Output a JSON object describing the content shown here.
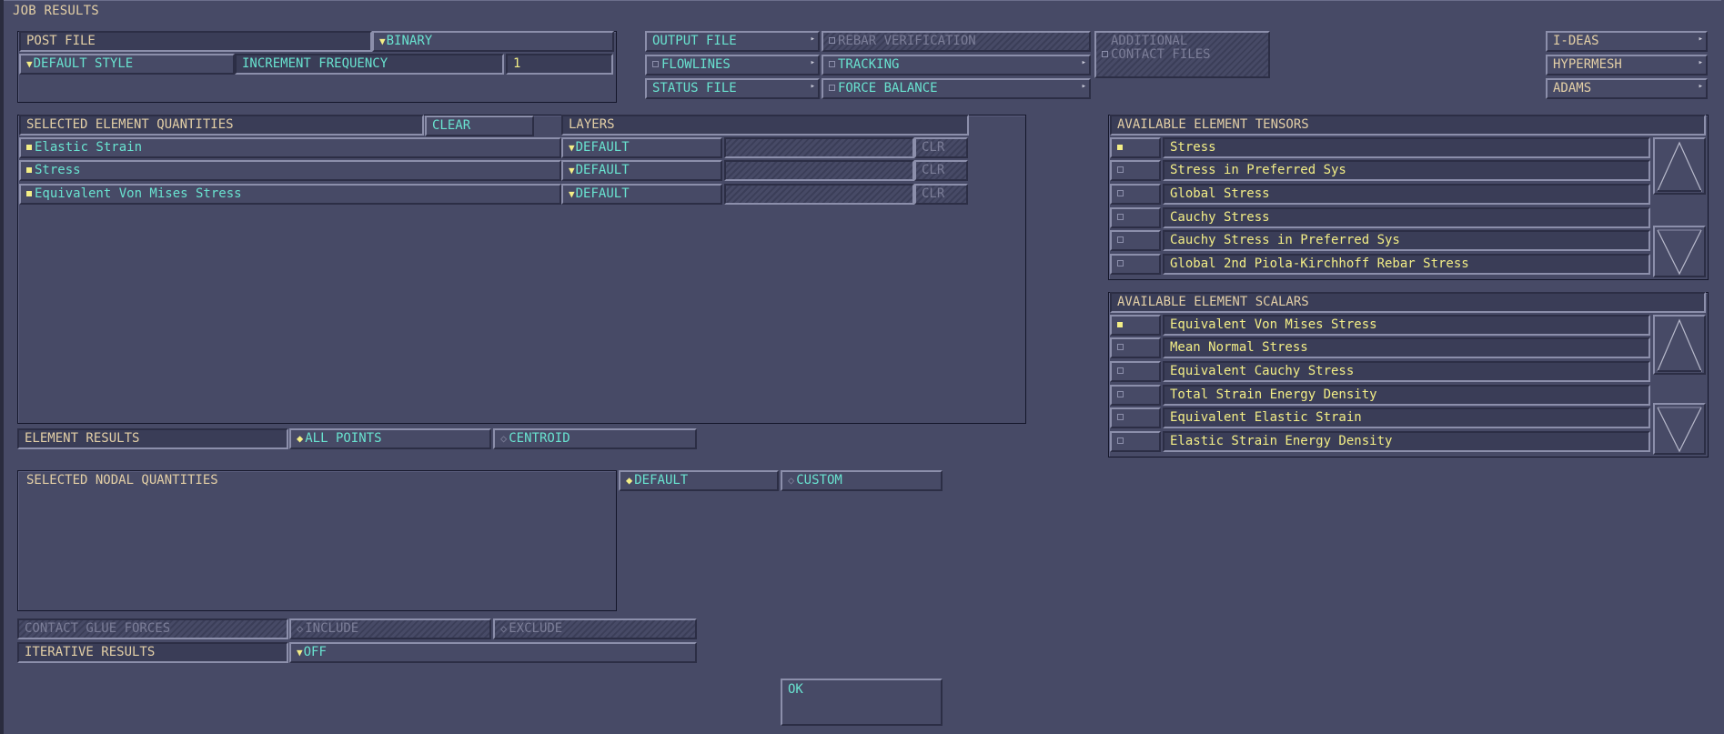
{
  "window": {
    "title": "JOB RESULTS"
  },
  "post_file": {
    "label": "POST FILE",
    "format": "BINARY",
    "style": "DEFAULT STYLE",
    "increment_label": "INCREMENT FREQUENCY",
    "increment_value": "1"
  },
  "files": {
    "output_file": "OUTPUT FILE",
    "flowlines": "FLOWLINES",
    "status_file": "STATUS FILE"
  },
  "checks": {
    "rebar_verification": "REBAR VERIFICATION",
    "tracking": "TRACKING",
    "force_balance": "FORCE BALANCE",
    "additional_contact_files": "ADDITIONAL CONTACT FILES"
  },
  "export": {
    "ideas": "I-DEAS",
    "hypermesh": "HYPERMESH",
    "adams": "ADAMS"
  },
  "selected_element": {
    "header": "SELECTED ELEMENT QUANTITIES",
    "clear": "CLEAR",
    "layers_header": "LAYERS",
    "rows": [
      {
        "name": "Elastic Strain",
        "layer": "DEFAULT",
        "clr": "CLR"
      },
      {
        "name": "Stress",
        "layer": "DEFAULT",
        "clr": "CLR"
      },
      {
        "name": "Equivalent Von Mises Stress",
        "layer": "DEFAULT",
        "clr": "CLR"
      }
    ]
  },
  "tensors": {
    "header": "AVAILABLE ELEMENT TENSORS",
    "items": [
      {
        "label": "Stress",
        "checked": true
      },
      {
        "label": "Stress in Preferred Sys",
        "checked": false
      },
      {
        "label": "Global Stress",
        "checked": false
      },
      {
        "label": "Cauchy Stress",
        "checked": false
      },
      {
        "label": "Cauchy Stress in Preferred Sys",
        "checked": false
      },
      {
        "label": "Global 2nd Piola-Kirchhoff Rebar Stress",
        "checked": false
      }
    ]
  },
  "scalars": {
    "header": "AVAILABLE ELEMENT SCALARS",
    "items": [
      {
        "label": "Equivalent Von Mises Stress",
        "checked": true
      },
      {
        "label": "Mean Normal Stress",
        "checked": false
      },
      {
        "label": "Equivalent Cauchy Stress",
        "checked": false
      },
      {
        "label": "Total Strain Energy Density",
        "checked": false
      },
      {
        "label": "Equivalent Elastic Strain",
        "checked": false
      },
      {
        "label": "Elastic Strain Energy Density",
        "checked": false
      }
    ]
  },
  "element_results": {
    "label": "ELEMENT RESULTS",
    "all_points": "ALL POINTS",
    "centroid": "CENTROID"
  },
  "nodal": {
    "header": "SELECTED NODAL QUANTITIES",
    "default": "DEFAULT",
    "custom": "CUSTOM"
  },
  "contact_glue": {
    "label": "CONTACT GLUE FORCES",
    "include": "INCLUDE",
    "exclude": "EXCLUDE"
  },
  "iterative": {
    "label": "ITERATIVE RESULTS",
    "value": "OFF"
  },
  "ok": "OK",
  "colors": {
    "background": "#474a66",
    "label": "#e3cfa6",
    "value": "#69e3d0",
    "list_text": "#f3ee86"
  }
}
